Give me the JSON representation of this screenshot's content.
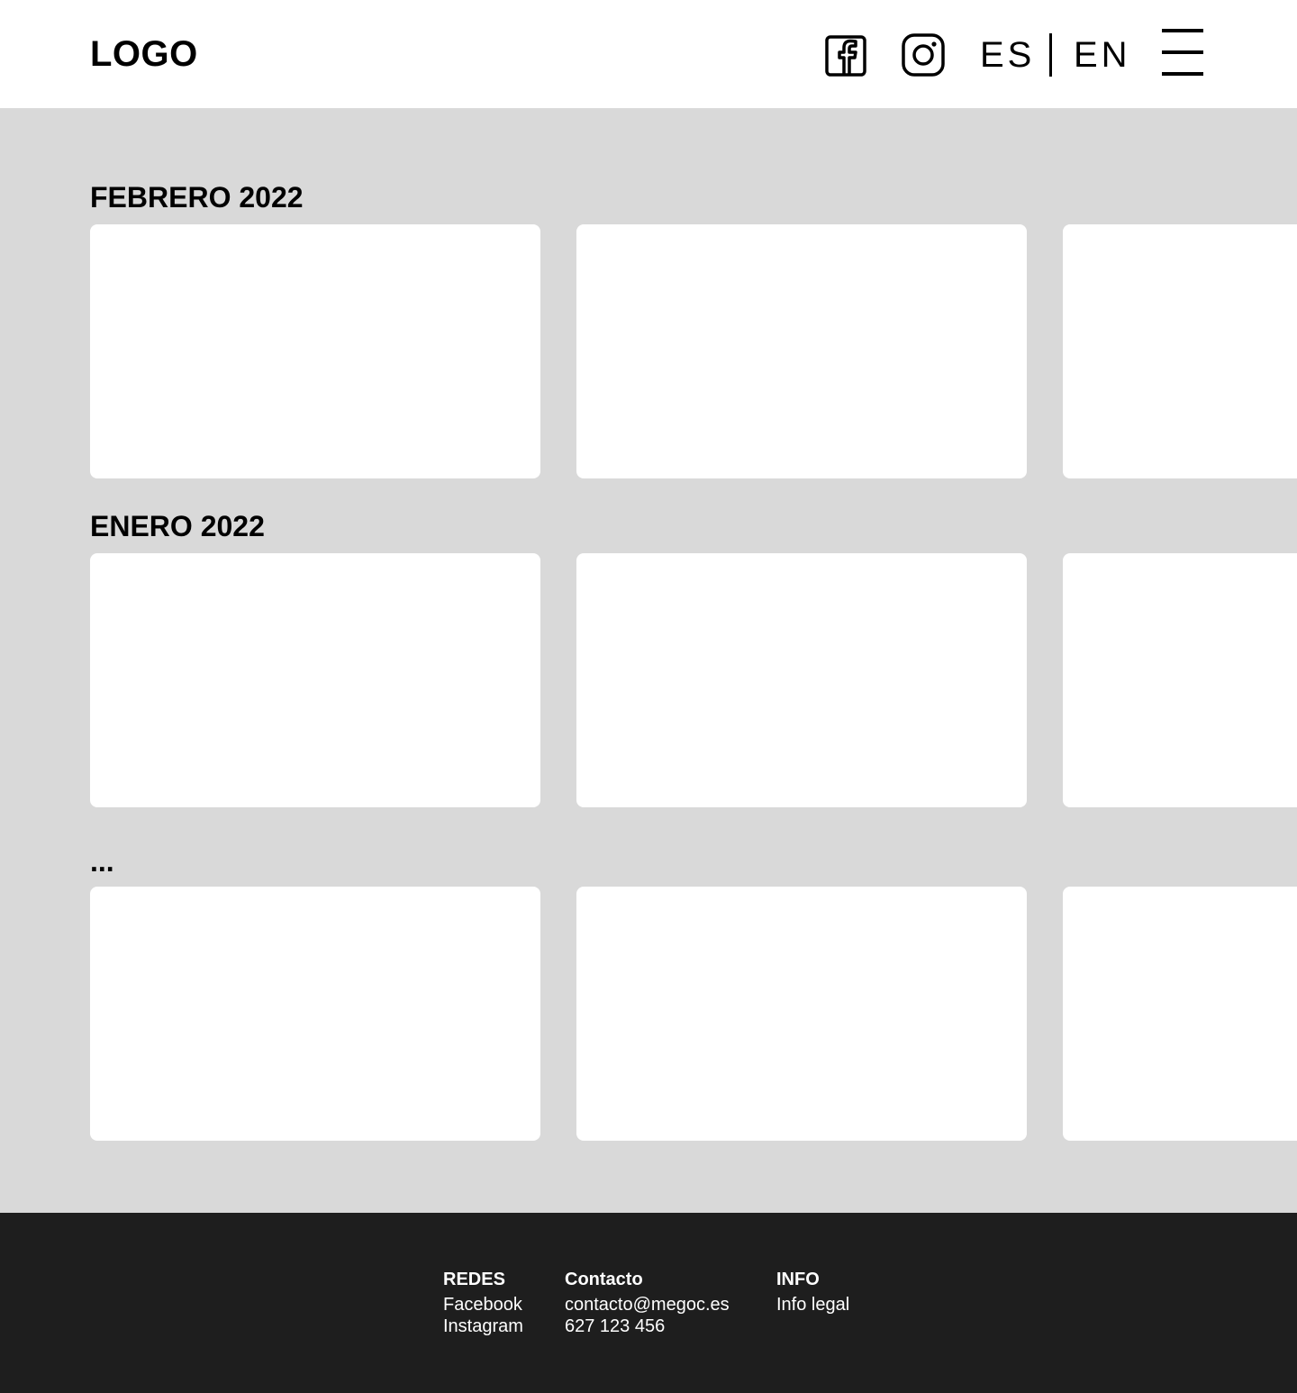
{
  "header": {
    "logo": "LOGO",
    "lang_es": "ES",
    "lang_en": "EN"
  },
  "icons": {
    "facebook": "facebook-icon",
    "instagram": "instagram-icon",
    "menu": "hamburger-menu-icon"
  },
  "sections": [
    {
      "title": "FEBRERO 2022"
    },
    {
      "title": "ENERO 2022"
    },
    {
      "title": "..."
    }
  ],
  "footer": {
    "redes": {
      "title": "REDES",
      "links": [
        "Facebook",
        "Instagram"
      ]
    },
    "contacto": {
      "title": "Contacto",
      "email": "contacto@megoc.es",
      "phone": "627 123 456"
    },
    "info": {
      "title": "INFO",
      "links": [
        "Info legal"
      ]
    }
  },
  "colors": {
    "header_bg": "#ffffff",
    "main_bg": "#d9d9d9",
    "card_bg": "#ffffff",
    "footer_bg": "#1e1e1e",
    "text": "#000000",
    "footer_text": "#ffffff"
  }
}
